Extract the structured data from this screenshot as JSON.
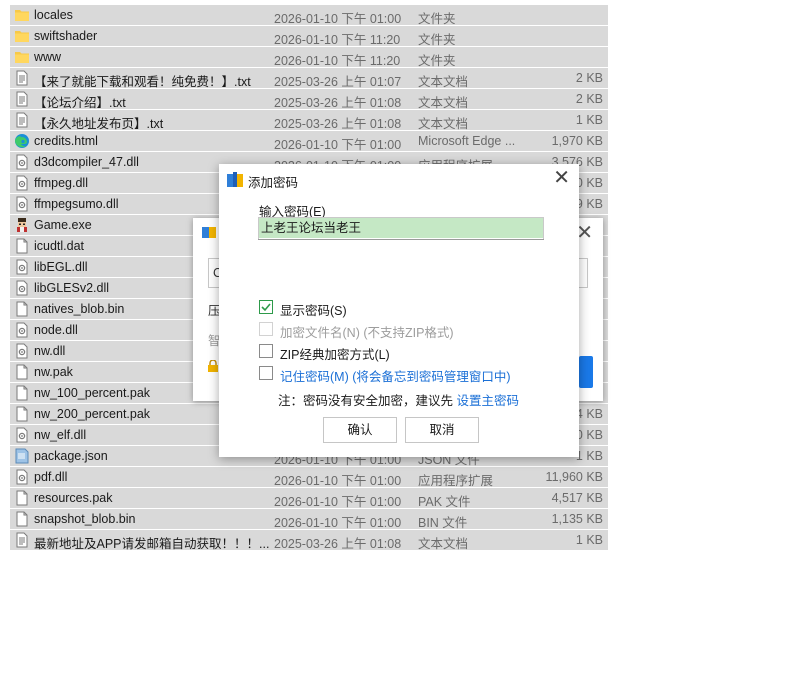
{
  "files": [
    {
      "name": "locales",
      "date": "2026-01-10 下午 01:00",
      "type": "文件夹",
      "size": "",
      "icon": "folder-icon"
    },
    {
      "name": "swiftshader",
      "date": "2026-01-10 下午 11:20",
      "type": "文件夹",
      "size": "",
      "icon": "folder-icon"
    },
    {
      "name": "www",
      "date": "2026-01-10 下午 11:20",
      "type": "文件夹",
      "size": "",
      "icon": "folder-icon"
    },
    {
      "name": "【来了就能下载和观看！纯免费！】.txt",
      "date": "2025-03-26 上午 01:07",
      "type": "文本文档",
      "size": "2 KB",
      "icon": "text-file-icon"
    },
    {
      "name": "【论坛介绍】.txt",
      "date": "2025-03-26 上午 01:08",
      "type": "文本文档",
      "size": "2 KB",
      "icon": "text-file-icon"
    },
    {
      "name": "【永久地址发布页】.txt",
      "date": "2025-03-26 上午 01:08",
      "type": "文本文档",
      "size": "1 KB",
      "icon": "text-file-icon"
    },
    {
      "name": "credits.html",
      "date": "2026-01-10 下午 01:00",
      "type": "Microsoft Edge ...",
      "size": "1,970 KB",
      "icon": "edge-browser-icon"
    },
    {
      "name": "d3dcompiler_47.dll",
      "date": "2026-01-10 下午 01:00",
      "type": "应用程序扩展",
      "size": "3,576 KB",
      "icon": "dll-file-icon"
    },
    {
      "name": "ffmpeg.dll",
      "date": "",
      "type": "",
      "size": "0 KB",
      "icon": "dll-file-icon"
    },
    {
      "name": "ffmpegsumo.dll",
      "date": "",
      "type": "",
      "size": "9 KB",
      "icon": "dll-file-icon"
    },
    {
      "name": "Game.exe",
      "date": "",
      "type": "",
      "size": "",
      "icon": "game-exe-icon"
    },
    {
      "name": "icudtl.dat",
      "date": "",
      "type": "",
      "size": "",
      "icon": "blank-file-icon"
    },
    {
      "name": "libEGL.dll",
      "date": "",
      "type": "",
      "size": "",
      "icon": "dll-file-icon"
    },
    {
      "name": "libGLESv2.dll",
      "date": "",
      "type": "",
      "size": "",
      "icon": "dll-file-icon"
    },
    {
      "name": "natives_blob.bin",
      "date": "",
      "type": "",
      "size": "",
      "icon": "blank-file-icon"
    },
    {
      "name": "node.dll",
      "date": "",
      "type": "",
      "size": "",
      "icon": "dll-file-icon"
    },
    {
      "name": "nw.dll",
      "date": "",
      "type": "",
      "size": "",
      "icon": "dll-file-icon"
    },
    {
      "name": "nw.pak",
      "date": "",
      "type": "",
      "size": "",
      "icon": "blank-file-icon"
    },
    {
      "name": "nw_100_percent.pak",
      "date": "",
      "type": "",
      "size": "",
      "icon": "blank-file-icon"
    },
    {
      "name": "nw_200_percent.pak",
      "date": "",
      "type": "",
      "size": "4 KB",
      "icon": "blank-file-icon"
    },
    {
      "name": "nw_elf.dll",
      "date": "",
      "type": "",
      "size": "0 KB",
      "icon": "dll-file-icon"
    },
    {
      "name": "package.json",
      "date": "2026-01-10 下午 01:00",
      "type": "JSON 文件",
      "size": "1 KB",
      "icon": "json-file-icon"
    },
    {
      "name": "pdf.dll",
      "date": "2026-01-10 下午 01:00",
      "type": "应用程序扩展",
      "size": "11,960 KB",
      "icon": "dll-file-icon"
    },
    {
      "name": "resources.pak",
      "date": "2026-01-10 下午 01:00",
      "type": "PAK 文件",
      "size": "4,517 KB",
      "icon": "blank-file-icon"
    },
    {
      "name": "snapshot_blob.bin",
      "date": "2026-01-10 下午 01:00",
      "type": "BIN 文件",
      "size": "1,135 KB",
      "icon": "blank-file-icon"
    },
    {
      "name": "最新地址及APP请发邮箱自动获取！！！....",
      "date": "2025-03-26 上午 01:08",
      "type": "文本文档",
      "size": "1 KB",
      "icon": "text-file-icon"
    }
  ],
  "back_dialog": {
    "field_text": "C",
    "text1": "压",
    "text2": "智"
  },
  "dialog": {
    "title": "添加密码",
    "close_glyph": "✕",
    "input_label": "输入密码(E)",
    "password_value": "上老王论坛当老王",
    "options": [
      {
        "label": "显示密码(S)",
        "checked": true,
        "disabled": false,
        "link": false
      },
      {
        "label": "加密文件名(N)  (不支持ZIP格式)",
        "checked": false,
        "disabled": true,
        "link": false
      },
      {
        "label": "ZIP经典加密方式(L)",
        "checked": false,
        "disabled": false,
        "link": false
      },
      {
        "label": "记住密码(M)  (将会备忘到密码管理窗口中)",
        "checked": false,
        "disabled": false,
        "link": true
      }
    ],
    "note_prefix": "注：密码没有安全加密，建议先 ",
    "note_link": "设置主密码",
    "ok_label": "确认",
    "cancel_label": "取消"
  },
  "colors": {
    "list_background": "#d9d9d9",
    "selection_green": "#c5e8c5",
    "checkbox_green": "#2e9a4a",
    "link_blue": "#1a6fd6",
    "accent_blue": "#1a79e8"
  }
}
